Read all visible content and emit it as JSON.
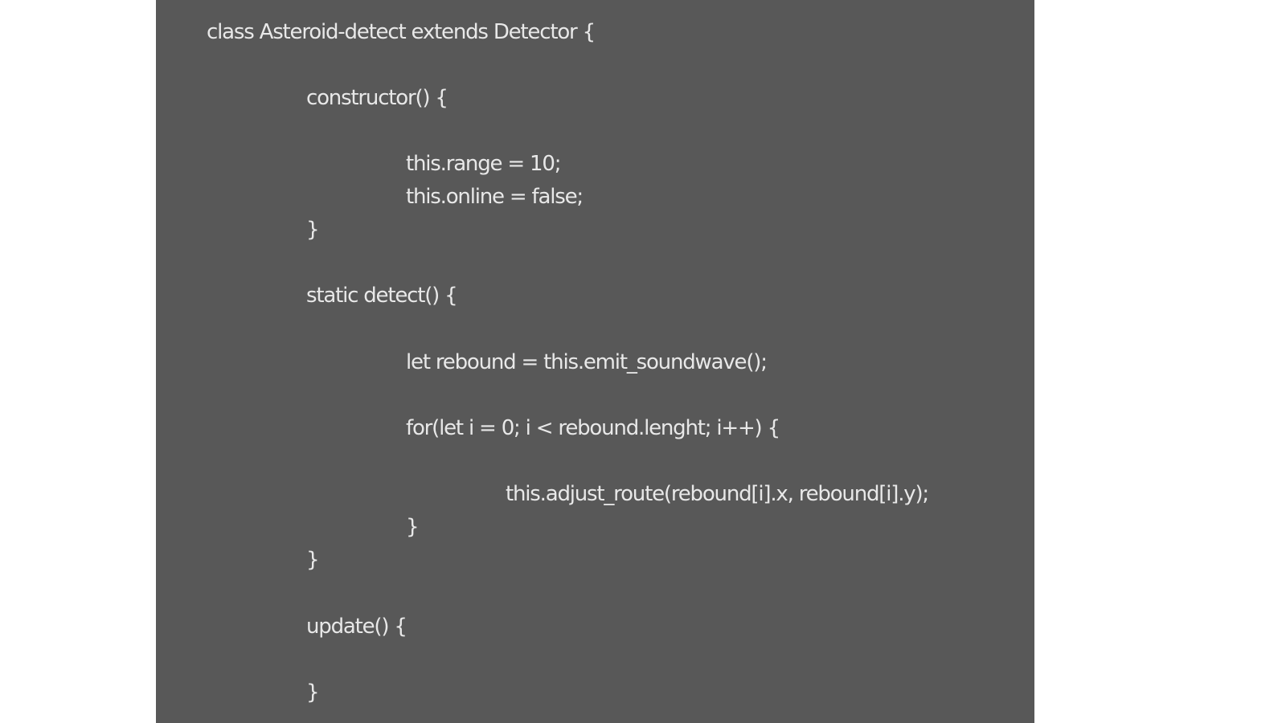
{
  "code": {
    "lines": [
      "class Asteroid-detect extends Detector {",
      "constructor() {",
      "this.range = 10;",
      "this.online = false;",
      "}",
      "static detect() {",
      "let rebound = this.emit_soundwave();",
      "for(let i = 0; i < rebound.lenght; i++) {",
      "this.adjust_route(rebound[i].x, rebound[i].y);",
      "}",
      "}",
      "update() {",
      "}"
    ]
  },
  "colors": {
    "panel_background": "#585858",
    "text": "#e8e8e8",
    "page_background": "#ffffff"
  }
}
